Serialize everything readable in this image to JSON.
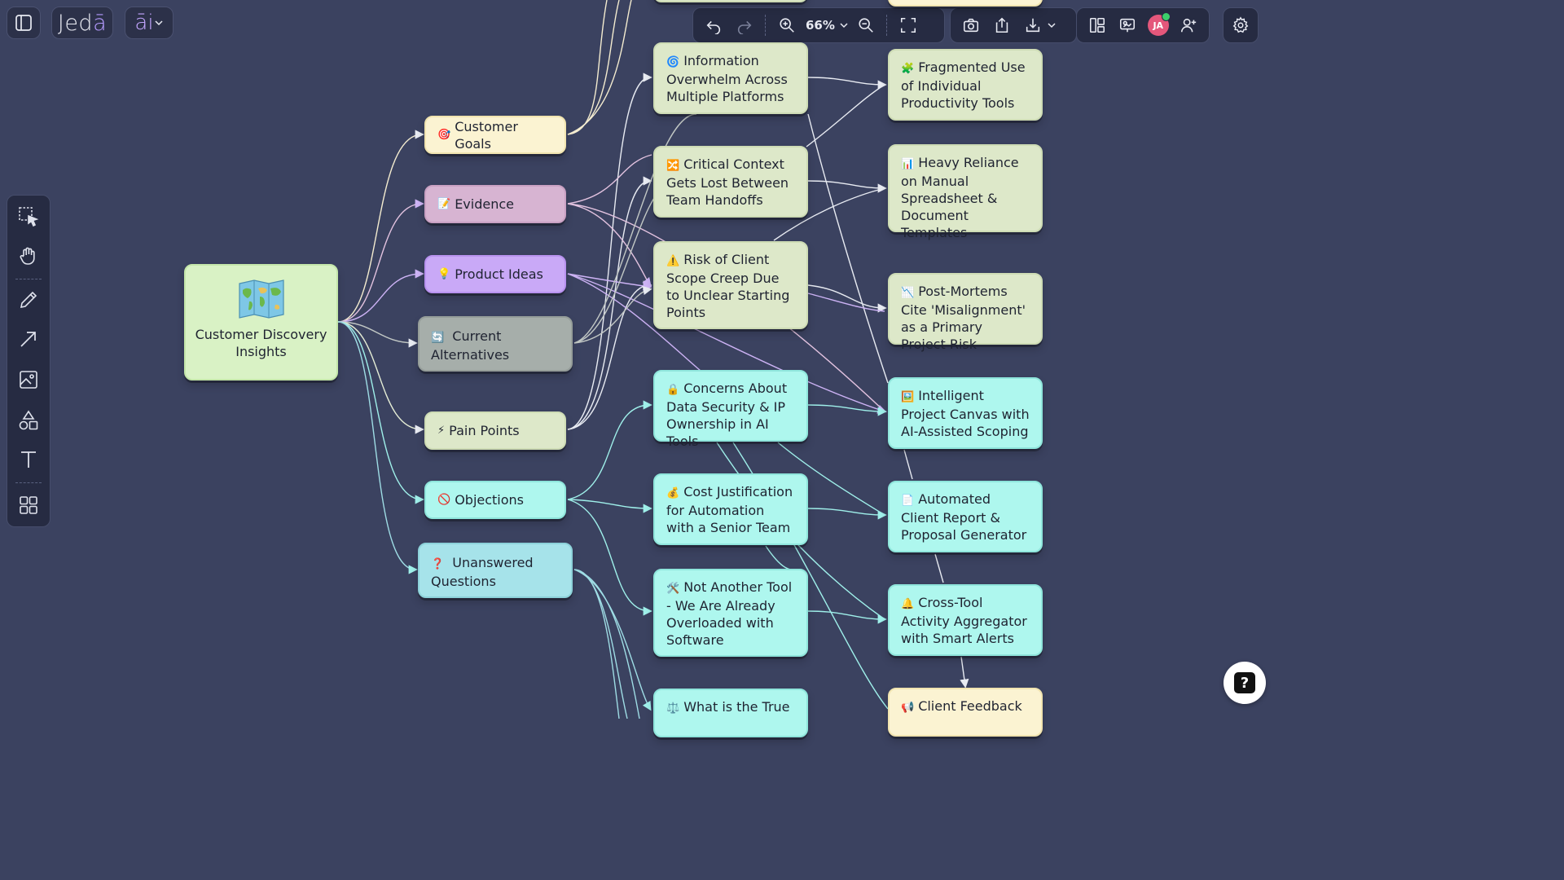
{
  "app": {
    "brand": "Jed",
    "brand_accent": "ā",
    "ai_label": "āi"
  },
  "toolbar": {
    "zoom": "66%"
  },
  "user": {
    "initials": "JA"
  },
  "help": {
    "label": "?"
  },
  "root": {
    "label": "Customer Discovery Insights",
    "icon": "world-map-icon"
  },
  "categories": {
    "customer_goals": {
      "emoji": "🎯",
      "label": "Customer Goals"
    },
    "evidence": {
      "emoji": "📝",
      "label": "Evidence"
    },
    "product_ideas": {
      "emoji": "💡",
      "label": "Product Ideas"
    },
    "current_alternatives": {
      "emoji": "🔄",
      "label": "Current Alternatives"
    },
    "pain_points": {
      "emoji": "⚡",
      "label": "Pain Points"
    },
    "objections": {
      "emoji": "🚫",
      "label": "Objections"
    },
    "unanswered_questions": {
      "emoji": "❓",
      "label": "Unanswered Questions"
    }
  },
  "pains": {
    "info_overwhelm": {
      "emoji": "🌀",
      "label": "Information Overwhelm Across Multiple Platforms"
    },
    "context_lost": {
      "emoji": "🔀",
      "label": "Critical Context Gets Lost Between Team Handoffs"
    },
    "scope_creep": {
      "emoji": "⚠️",
      "label": "Risk of Client Scope Creep Due to Unclear Starting Points"
    }
  },
  "objections": {
    "data_security": {
      "emoji": "🔒",
      "label": "Concerns About Data Security & IP Ownership in AI Tools"
    },
    "cost_justification": {
      "emoji": "💰",
      "label": "Cost Justification for Automation with a Senior Team"
    },
    "not_another_tool": {
      "emoji": "🛠️",
      "label": "Not Another Tool - We Are Already Overloaded with Software"
    },
    "true_cost": {
      "emoji": "⚖️",
      "label": "What is the True"
    }
  },
  "right_nodes": {
    "fragmented_use": {
      "emoji": "🧩",
      "label": "Fragmented Use of Individual Productivity Tools"
    },
    "spreadsheet_reliance": {
      "emoji": "📊",
      "label": "Heavy Reliance on Manual Spreadsheet & Document Templates"
    },
    "post_mortems": {
      "emoji": "📉",
      "label": "Post-Mortems Cite 'Misalignment' as a Primary Project Risk"
    },
    "project_canvas": {
      "emoji": "🖼️",
      "label": "Intelligent Project Canvas with AI-Assisted Scoping"
    },
    "report_generator": {
      "emoji": "📄",
      "label": "Automated Client Report & Proposal Generator"
    },
    "activity_aggregator": {
      "emoji": "🔔",
      "label": "Cross-Tool Activity Aggregator with Smart Alerts"
    },
    "client_feedback": {
      "emoji": "📢",
      "label": "Client Feedback"
    }
  }
}
